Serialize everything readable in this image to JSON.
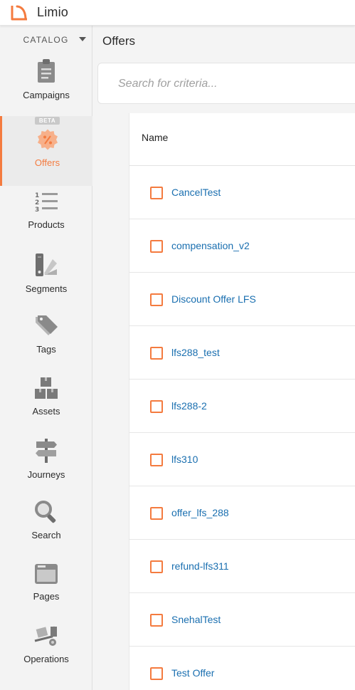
{
  "app": {
    "brand": "Limio"
  },
  "sidebar": {
    "section": "CATALOG",
    "items": [
      {
        "label": "Campaigns",
        "icon": "clipboard-icon",
        "active": false
      },
      {
        "label": "Offers",
        "icon": "discount-badge-icon",
        "badge": "BETA",
        "active": true
      },
      {
        "label": "Products",
        "icon": "numbered-list-icon",
        "active": false
      },
      {
        "label": "Segments",
        "icon": "swatch-icon",
        "active": false
      },
      {
        "label": "Tags",
        "icon": "tags-icon",
        "active": false
      },
      {
        "label": "Assets",
        "icon": "boxes-icon",
        "active": false
      },
      {
        "label": "Journeys",
        "icon": "signpost-icon",
        "active": false
      },
      {
        "label": "Search",
        "icon": "search-icon",
        "active": false
      },
      {
        "label": "Pages",
        "icon": "browser-window-icon",
        "active": false
      },
      {
        "label": "Operations",
        "icon": "hand-truck-icon",
        "active": false
      }
    ]
  },
  "main": {
    "title": "Offers",
    "search": {
      "placeholder": "Search for criteria..."
    },
    "table": {
      "columns": [
        "Name"
      ],
      "rows": [
        "CancelTest",
        "compensation_v2",
        "Discount Offer LFS",
        "lfs288_test",
        "lfs288-2",
        "lfs310",
        "offer_lfs_288",
        "refund-lfs311",
        "SnehalTest",
        "Test Offer"
      ]
    }
  },
  "colors": {
    "accent": "#f47b3f",
    "link": "#1a6fb0",
    "icon_gray": "#8a8a8a"
  }
}
